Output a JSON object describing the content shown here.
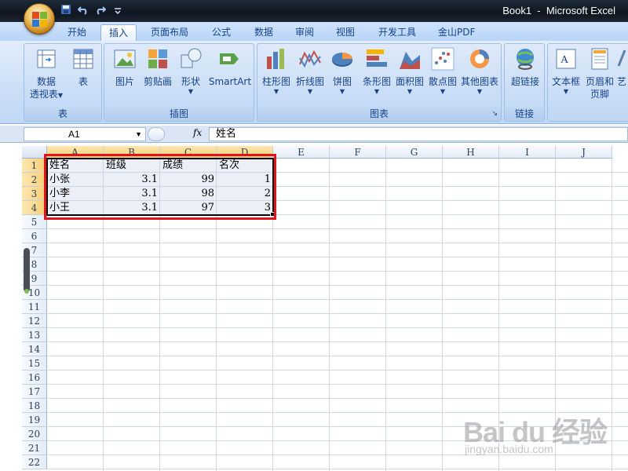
{
  "window": {
    "title": "Book1  -  Microsoft Excel"
  },
  "quick_access": {
    "icons": [
      "save-icon",
      "undo-icon",
      "redo-icon",
      "customize-icon"
    ]
  },
  "tabs": [
    {
      "label": "开始",
      "active": false
    },
    {
      "label": "插入",
      "active": true
    },
    {
      "label": "页面布局",
      "active": false
    },
    {
      "label": "公式",
      "active": false
    },
    {
      "label": "数据",
      "active": false
    },
    {
      "label": "审阅",
      "active": false
    },
    {
      "label": "视图",
      "active": false
    },
    {
      "label": "开发工具",
      "active": false
    },
    {
      "label": "金山PDF",
      "active": false
    }
  ],
  "ribbon": {
    "groups": {
      "tables": {
        "title": "表",
        "pivot_line1": "数据",
        "pivot_line2": "透视表",
        "table": "表"
      },
      "illustrations": {
        "title": "插图",
        "picture": "图片",
        "clipart": "剪贴画",
        "shapes": "形状",
        "smartart": "SmartArt"
      },
      "charts": {
        "title": "图表",
        "column": "柱形图",
        "line": "折线图",
        "pie": "饼图",
        "bar": "条形图",
        "area": "面积图",
        "scatter": "散点图",
        "other": "其他图表"
      },
      "links": {
        "title": "链接",
        "hyperlink": "超链接"
      },
      "text": {
        "textbox": "文本框",
        "header_line1": "页眉和",
        "header_line2": "页脚",
        "wordart": "艺"
      }
    },
    "accent_colors": {
      "ribbon_bg": "#c7dcf6",
      "group_border": "#9ebfe8",
      "text": "#15428b"
    }
  },
  "formula_bar": {
    "name_box": "A1",
    "fx_label": "fx",
    "content": "姓名"
  },
  "sheet": {
    "columns": [
      "A",
      "B",
      "C",
      "D",
      "E",
      "F",
      "G",
      "H",
      "I",
      "J"
    ],
    "rows": [
      "1",
      "2",
      "3",
      "4",
      "5",
      "6",
      "7",
      "8",
      "9",
      "10",
      "11",
      "12",
      "13",
      "14",
      "15",
      "16",
      "17",
      "18",
      "19",
      "20",
      "21",
      "22"
    ],
    "header": [
      "姓名",
      "班级",
      "成绩",
      "名次"
    ],
    "data": [
      [
        "小张",
        "3.1",
        "99",
        "1"
      ],
      [
        "小李",
        "3.1",
        "98",
        "2"
      ],
      [
        "小王",
        "3.1",
        "97",
        "3"
      ]
    ],
    "selection": "A1:D4",
    "highlight_color": "#e1141c"
  },
  "watermark": {
    "brand": "Bai du 经验",
    "url": "jingyan.baidu.com"
  }
}
